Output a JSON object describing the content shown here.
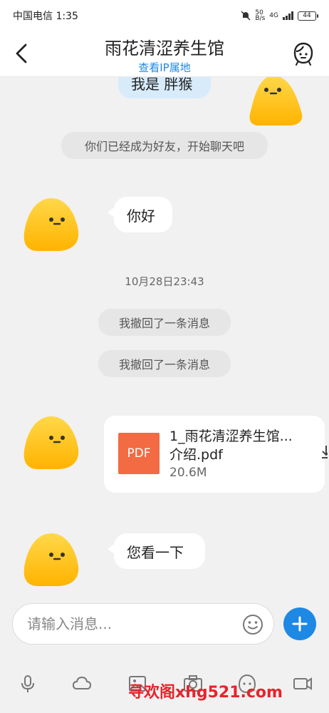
{
  "status_bar": {
    "carrier_time": "中国电信 1:35",
    "net_speed_top": "50",
    "net_speed_bottom": "B/s",
    "network_type": "4G",
    "battery": "44"
  },
  "header": {
    "title": "雨花清涩养生馆",
    "subtitle": "查看IP属地"
  },
  "messages": {
    "outgoing_partial": "我是 胖猴",
    "system_friend": "你们已经成为好友，开始聊天吧",
    "greeting": "你好",
    "timestamp": "10月28日23:43",
    "recall_1": "我撤回了一条消息",
    "recall_2": "我撤回了一条消息",
    "file": {
      "icon_label": "PDF",
      "name_line1": "1_雨花清涩养生馆...",
      "name_line2": "介绍.pdf",
      "size": "20.6M"
    },
    "look": "您看一下"
  },
  "input": {
    "placeholder": "请输入消息..."
  },
  "toolbar": {
    "icons": [
      "microphone-icon",
      "cloud-icon",
      "image-icon",
      "camera-icon",
      "emoji-icon",
      "video-icon"
    ]
  },
  "watermark": "寻欢阁xhg521.com",
  "colors": {
    "accent": "#1e88e5",
    "pdf": "#f26b43",
    "avatar": "#ffc61a",
    "watermark": "#e8232a"
  }
}
